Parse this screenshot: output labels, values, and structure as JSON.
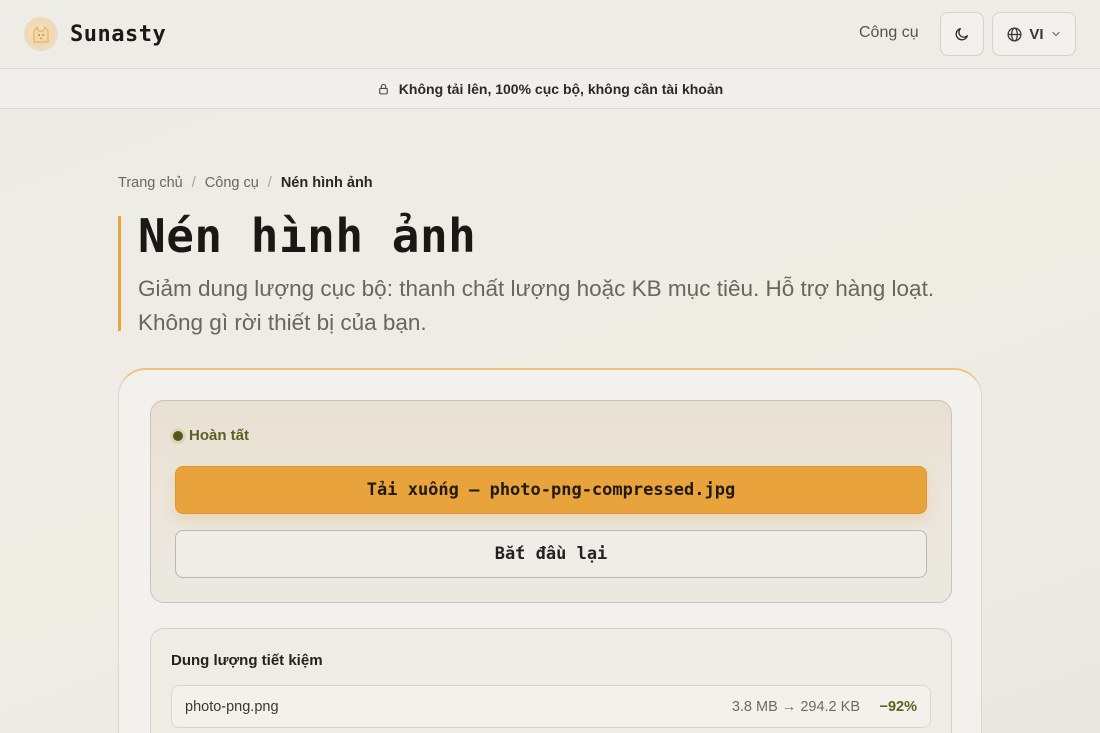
{
  "header": {
    "brand_name": "Sunasty",
    "logo_icon": "cat-icon",
    "nav_tools": "Công cụ",
    "theme_icon": "moon-icon",
    "language_icon": "globe-icon",
    "language": "VI"
  },
  "banner": {
    "icon": "lock-icon",
    "text": "Không tải lên, 100% cục bộ, không cần tài khoản"
  },
  "breadcrumb": {
    "home": "Trang chủ",
    "tools": "Công cụ",
    "current": "Nén hình ảnh"
  },
  "page": {
    "title": "Nén hình ảnh",
    "subtitle": "Giảm dung lượng cục bộ: thanh chất lượng hoặc KB mục tiêu. Hỗ trợ hàng loạt. Không gì rời thiết bị của bạn."
  },
  "result": {
    "status_label": "Hoàn tất",
    "download_label": "Tải xuống — photo-png-compressed.jpg",
    "restart_label": "Bắt đầu lại"
  },
  "savings": {
    "title": "Dung lượng tiết kiệm",
    "files": [
      {
        "name": "photo-png.png",
        "sizes": "3.8 MB → 294.2 KB",
        "percent": "−92%"
      }
    ]
  },
  "colors": {
    "accent": "#e9a33d",
    "status_green": "#5b5f20"
  }
}
